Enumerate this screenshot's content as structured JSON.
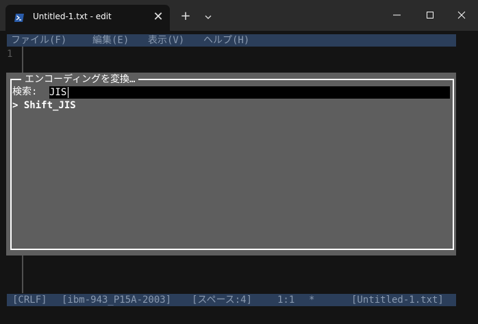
{
  "window": {
    "tab_title": "Untitled-1.txt - edit",
    "close_tab_glyph": "✕",
    "new_tab_glyph": "+"
  },
  "editor": {
    "menu": [
      "ファイル(F)",
      "編集(E)",
      "表示(V)",
      "ヘルプ(H)"
    ],
    "line_number": "1"
  },
  "dialog": {
    "title": "エンコーディングを変換…",
    "search_label": "検索:",
    "search_value": "JIS",
    "results": [
      "> Shift_JIS"
    ]
  },
  "statusbar": {
    "line_ending": "[CRLF]",
    "encoding": "[ibm-943_P15A-2003]",
    "indent": "[スペース:4]",
    "position": "1:1",
    "modified": "*",
    "filename": "[Untitled-1.txt]"
  },
  "colors": {
    "bar_bg": "#2b3e5a",
    "bar_fg": "#8a9ab0",
    "dialog_bg": "#5e5e5e",
    "terminal_bg": "#141414"
  }
}
